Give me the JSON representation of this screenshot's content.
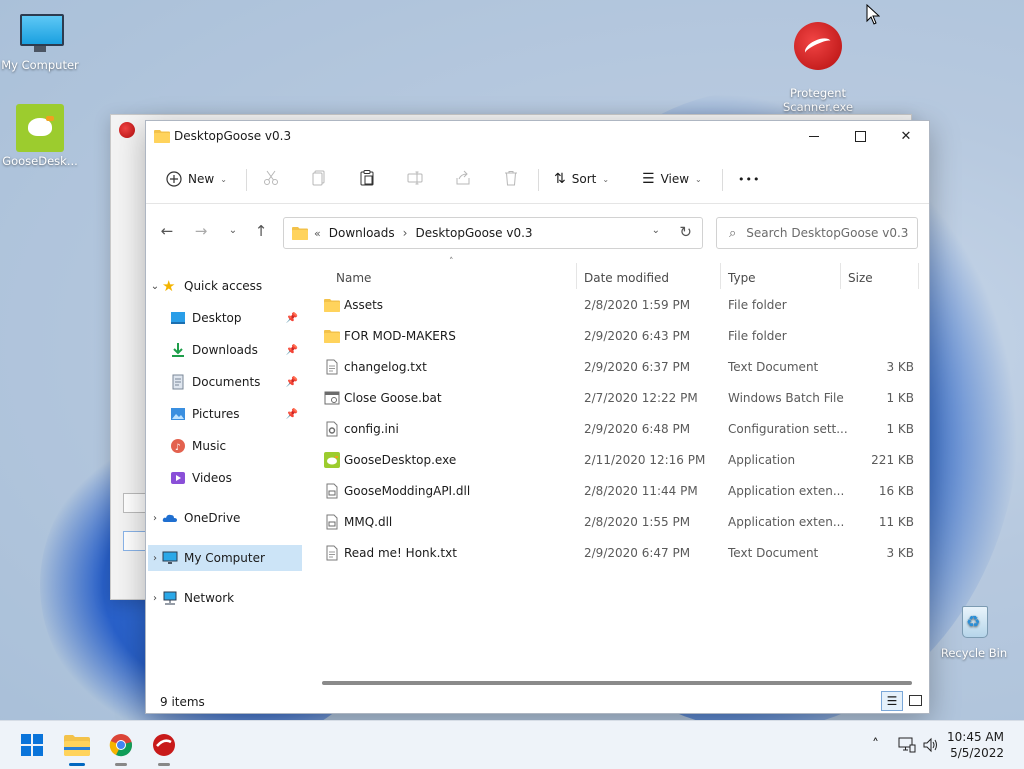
{
  "desktop": {
    "icons": [
      {
        "label": "My Computer",
        "icon": "monitor-icon"
      },
      {
        "label": "GooseDesk...",
        "icon": "goose-icon"
      },
      {
        "label": "Protegent\nScanner.exe",
        "icon": "protegent-icon"
      },
      {
        "label": "Recycle Bin",
        "icon": "recycle-bin-icon"
      }
    ]
  },
  "window": {
    "title": "DesktopGoose v0.3",
    "controls": {
      "minimize": "minimize",
      "maximize": "maximize",
      "close": "close"
    }
  },
  "toolbar": {
    "new_label": "New",
    "sort_label": "Sort",
    "view_label": "View",
    "more_label": "•••",
    "icons": [
      "cut-icon",
      "copy-icon",
      "paste-icon",
      "rename-icon",
      "share-icon",
      "delete-icon"
    ]
  },
  "address": {
    "lead": "«",
    "crumbs": [
      "Downloads",
      "DesktopGoose v0.3"
    ]
  },
  "search": {
    "placeholder": "Search DesktopGoose v0.3"
  },
  "sidebar": {
    "quick_access": "Quick access",
    "items": [
      {
        "label": "Desktop",
        "icon": "desktop-icon",
        "pinned": true
      },
      {
        "label": "Downloads",
        "icon": "download-icon",
        "pinned": true
      },
      {
        "label": "Documents",
        "icon": "documents-icon",
        "pinned": true
      },
      {
        "label": "Pictures",
        "icon": "pictures-icon",
        "pinned": true
      },
      {
        "label": "Music",
        "icon": "music-icon",
        "pinned": false
      },
      {
        "label": "Videos",
        "icon": "videos-icon",
        "pinned": false
      }
    ],
    "onedrive": "OneDrive",
    "my_computer": "My Computer",
    "network": "Network"
  },
  "filelist": {
    "columns": [
      "Name",
      "Date modified",
      "Type",
      "Size"
    ],
    "rows": [
      {
        "name": "Assets",
        "date": "2/8/2020 1:59 PM",
        "type": "File folder",
        "size": "",
        "icon": "folder-icon"
      },
      {
        "name": "FOR MOD-MAKERS",
        "date": "2/9/2020 6:43 PM",
        "type": "File folder",
        "size": "",
        "icon": "folder-icon"
      },
      {
        "name": "changelog.txt",
        "date": "2/9/2020 6:37 PM",
        "type": "Text Document",
        "size": "3 KB",
        "icon": "text-file-icon"
      },
      {
        "name": "Close Goose.bat",
        "date": "2/7/2020 12:22 PM",
        "type": "Windows Batch File",
        "size": "1 KB",
        "icon": "batch-file-icon"
      },
      {
        "name": "config.ini",
        "date": "2/9/2020 6:48 PM",
        "type": "Configuration sett...",
        "size": "1 KB",
        "icon": "config-file-icon"
      },
      {
        "name": "GooseDesktop.exe",
        "date": "2/11/2020 12:16 PM",
        "type": "Application",
        "size": "221 KB",
        "icon": "goose-app-icon"
      },
      {
        "name": "GooseModdingAPI.dll",
        "date": "2/8/2020 11:44 PM",
        "type": "Application exten...",
        "size": "16 KB",
        "icon": "dll-file-icon"
      },
      {
        "name": "MMQ.dll",
        "date": "2/8/2020 1:55 PM",
        "type": "Application exten...",
        "size": "11 KB",
        "icon": "dll-file-icon"
      },
      {
        "name": "Read me! Honk.txt",
        "date": "2/9/2020 6:47 PM",
        "type": "Text Document",
        "size": "3 KB",
        "icon": "text-file-icon"
      }
    ]
  },
  "status": {
    "item_count": "9 items"
  },
  "taskbar": {
    "apps": [
      "start-icon",
      "file-explorer-icon",
      "chrome-icon",
      "protegent-icon"
    ],
    "time": "10:45 AM",
    "date": "5/5/2022"
  },
  "colors": {
    "accent": "#0067c0",
    "selection": "#cce4f7",
    "folder": "#f3c24a"
  }
}
